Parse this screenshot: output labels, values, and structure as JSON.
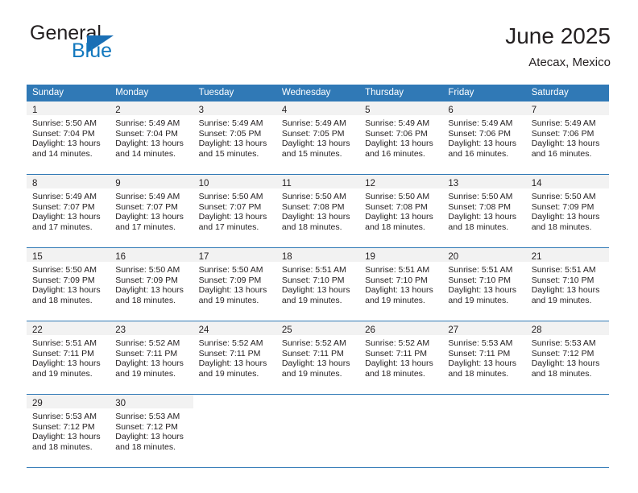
{
  "brand": {
    "word_general": "General",
    "word_blue": "Blue",
    "triangle_color": "#1a6fb5",
    "blue_color": "#1278be"
  },
  "header": {
    "title": "June 2025",
    "subtitle": "Atecax, Mexico"
  },
  "theme": {
    "header_blue": "#3079b6",
    "daynum_band": "#f2f2f2",
    "text": "#231f20"
  },
  "calendar": {
    "weekday_headers": [
      "Sunday",
      "Monday",
      "Tuesday",
      "Wednesday",
      "Thursday",
      "Friday",
      "Saturday"
    ],
    "weeks": [
      [
        {
          "day": "1",
          "sunrise": "Sunrise: 5:50 AM",
          "sunset": "Sunset: 7:04 PM",
          "daylight1": "Daylight: 13 hours",
          "daylight2": "and 14 minutes."
        },
        {
          "day": "2",
          "sunrise": "Sunrise: 5:49 AM",
          "sunset": "Sunset: 7:04 PM",
          "daylight1": "Daylight: 13 hours",
          "daylight2": "and 14 minutes."
        },
        {
          "day": "3",
          "sunrise": "Sunrise: 5:49 AM",
          "sunset": "Sunset: 7:05 PM",
          "daylight1": "Daylight: 13 hours",
          "daylight2": "and 15 minutes."
        },
        {
          "day": "4",
          "sunrise": "Sunrise: 5:49 AM",
          "sunset": "Sunset: 7:05 PM",
          "daylight1": "Daylight: 13 hours",
          "daylight2": "and 15 minutes."
        },
        {
          "day": "5",
          "sunrise": "Sunrise: 5:49 AM",
          "sunset": "Sunset: 7:06 PM",
          "daylight1": "Daylight: 13 hours",
          "daylight2": "and 16 minutes."
        },
        {
          "day": "6",
          "sunrise": "Sunrise: 5:49 AM",
          "sunset": "Sunset: 7:06 PM",
          "daylight1": "Daylight: 13 hours",
          "daylight2": "and 16 minutes."
        },
        {
          "day": "7",
          "sunrise": "Sunrise: 5:49 AM",
          "sunset": "Sunset: 7:06 PM",
          "daylight1": "Daylight: 13 hours",
          "daylight2": "and 16 minutes."
        }
      ],
      [
        {
          "day": "8",
          "sunrise": "Sunrise: 5:49 AM",
          "sunset": "Sunset: 7:07 PM",
          "daylight1": "Daylight: 13 hours",
          "daylight2": "and 17 minutes."
        },
        {
          "day": "9",
          "sunrise": "Sunrise: 5:49 AM",
          "sunset": "Sunset: 7:07 PM",
          "daylight1": "Daylight: 13 hours",
          "daylight2": "and 17 minutes."
        },
        {
          "day": "10",
          "sunrise": "Sunrise: 5:50 AM",
          "sunset": "Sunset: 7:07 PM",
          "daylight1": "Daylight: 13 hours",
          "daylight2": "and 17 minutes."
        },
        {
          "day": "11",
          "sunrise": "Sunrise: 5:50 AM",
          "sunset": "Sunset: 7:08 PM",
          "daylight1": "Daylight: 13 hours",
          "daylight2": "and 18 minutes."
        },
        {
          "day": "12",
          "sunrise": "Sunrise: 5:50 AM",
          "sunset": "Sunset: 7:08 PM",
          "daylight1": "Daylight: 13 hours",
          "daylight2": "and 18 minutes."
        },
        {
          "day": "13",
          "sunrise": "Sunrise: 5:50 AM",
          "sunset": "Sunset: 7:08 PM",
          "daylight1": "Daylight: 13 hours",
          "daylight2": "and 18 minutes."
        },
        {
          "day": "14",
          "sunrise": "Sunrise: 5:50 AM",
          "sunset": "Sunset: 7:09 PM",
          "daylight1": "Daylight: 13 hours",
          "daylight2": "and 18 minutes."
        }
      ],
      [
        {
          "day": "15",
          "sunrise": "Sunrise: 5:50 AM",
          "sunset": "Sunset: 7:09 PM",
          "daylight1": "Daylight: 13 hours",
          "daylight2": "and 18 minutes."
        },
        {
          "day": "16",
          "sunrise": "Sunrise: 5:50 AM",
          "sunset": "Sunset: 7:09 PM",
          "daylight1": "Daylight: 13 hours",
          "daylight2": "and 18 minutes."
        },
        {
          "day": "17",
          "sunrise": "Sunrise: 5:50 AM",
          "sunset": "Sunset: 7:09 PM",
          "daylight1": "Daylight: 13 hours",
          "daylight2": "and 19 minutes."
        },
        {
          "day": "18",
          "sunrise": "Sunrise: 5:51 AM",
          "sunset": "Sunset: 7:10 PM",
          "daylight1": "Daylight: 13 hours",
          "daylight2": "and 19 minutes."
        },
        {
          "day": "19",
          "sunrise": "Sunrise: 5:51 AM",
          "sunset": "Sunset: 7:10 PM",
          "daylight1": "Daylight: 13 hours",
          "daylight2": "and 19 minutes."
        },
        {
          "day": "20",
          "sunrise": "Sunrise: 5:51 AM",
          "sunset": "Sunset: 7:10 PM",
          "daylight1": "Daylight: 13 hours",
          "daylight2": "and 19 minutes."
        },
        {
          "day": "21",
          "sunrise": "Sunrise: 5:51 AM",
          "sunset": "Sunset: 7:10 PM",
          "daylight1": "Daylight: 13 hours",
          "daylight2": "and 19 minutes."
        }
      ],
      [
        {
          "day": "22",
          "sunrise": "Sunrise: 5:51 AM",
          "sunset": "Sunset: 7:11 PM",
          "daylight1": "Daylight: 13 hours",
          "daylight2": "and 19 minutes."
        },
        {
          "day": "23",
          "sunrise": "Sunrise: 5:52 AM",
          "sunset": "Sunset: 7:11 PM",
          "daylight1": "Daylight: 13 hours",
          "daylight2": "and 19 minutes."
        },
        {
          "day": "24",
          "sunrise": "Sunrise: 5:52 AM",
          "sunset": "Sunset: 7:11 PM",
          "daylight1": "Daylight: 13 hours",
          "daylight2": "and 19 minutes."
        },
        {
          "day": "25",
          "sunrise": "Sunrise: 5:52 AM",
          "sunset": "Sunset: 7:11 PM",
          "daylight1": "Daylight: 13 hours",
          "daylight2": "and 19 minutes."
        },
        {
          "day": "26",
          "sunrise": "Sunrise: 5:52 AM",
          "sunset": "Sunset: 7:11 PM",
          "daylight1": "Daylight: 13 hours",
          "daylight2": "and 18 minutes."
        },
        {
          "day": "27",
          "sunrise": "Sunrise: 5:53 AM",
          "sunset": "Sunset: 7:11 PM",
          "daylight1": "Daylight: 13 hours",
          "daylight2": "and 18 minutes."
        },
        {
          "day": "28",
          "sunrise": "Sunrise: 5:53 AM",
          "sunset": "Sunset: 7:12 PM",
          "daylight1": "Daylight: 13 hours",
          "daylight2": "and 18 minutes."
        }
      ],
      [
        {
          "day": "29",
          "sunrise": "Sunrise: 5:53 AM",
          "sunset": "Sunset: 7:12 PM",
          "daylight1": "Daylight: 13 hours",
          "daylight2": "and 18 minutes."
        },
        {
          "day": "30",
          "sunrise": "Sunrise: 5:53 AM",
          "sunset": "Sunset: 7:12 PM",
          "daylight1": "Daylight: 13 hours",
          "daylight2": "and 18 minutes."
        },
        {
          "day": "",
          "sunrise": "",
          "sunset": "",
          "daylight1": "",
          "daylight2": ""
        },
        {
          "day": "",
          "sunrise": "",
          "sunset": "",
          "daylight1": "",
          "daylight2": ""
        },
        {
          "day": "",
          "sunrise": "",
          "sunset": "",
          "daylight1": "",
          "daylight2": ""
        },
        {
          "day": "",
          "sunrise": "",
          "sunset": "",
          "daylight1": "",
          "daylight2": ""
        },
        {
          "day": "",
          "sunrise": "",
          "sunset": "",
          "daylight1": "",
          "daylight2": ""
        }
      ]
    ]
  }
}
